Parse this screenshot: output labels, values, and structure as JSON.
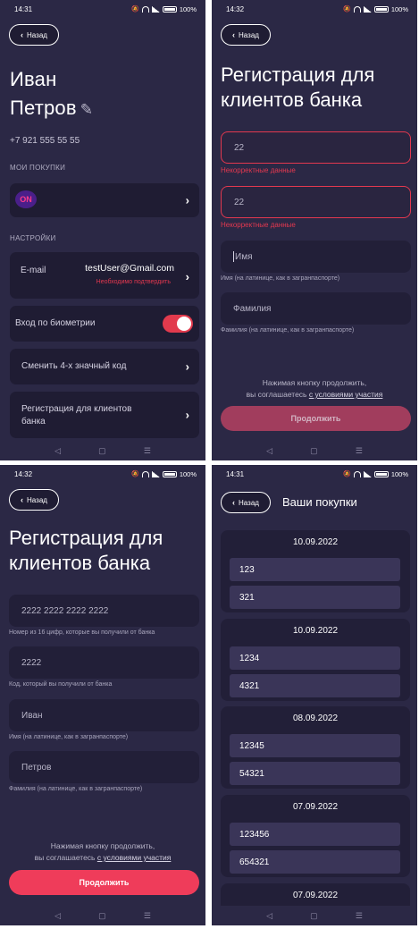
{
  "screen1": {
    "status": {
      "time": "14:31",
      "battery": "100%"
    },
    "back_label": "Назад",
    "first_name": "Иван",
    "last_name": "Петров",
    "phone": "+7 921 555 55 55",
    "purchases_header": "МОИ ПОКУПКИ",
    "partner_logo": "ON",
    "settings_header": "НАСТРОЙКИ",
    "email_label": "E-mail",
    "email_value": "testUser@Gmail.com",
    "email_warning": "Необходимо подтвердить",
    "biometric_label": "Вход по биометрии",
    "change_code_label": "Сменить 4-х значный код",
    "bank_reg_label": "Регистрация для клиентов банка"
  },
  "screen2": {
    "status": {
      "time": "14:32",
      "battery": "100%"
    },
    "back_label": "Назад",
    "title": "Регистрация для клиентов банка",
    "field1_value": "22",
    "field1_error": "Некорректные данные",
    "field2_value": "22",
    "field2_error": "Некорректные данные",
    "first_name_placeholder": "Имя",
    "first_name_hint": "Имя (на латинице, как в загранпаспорте)",
    "last_name_placeholder": "Фамилия",
    "last_name_hint": "Фамилия (на латинице, как в загранпаспорте)",
    "agree_line1": "Нажимая кнопку продолжить,",
    "agree_prefix": "вы соглашаетесь ",
    "agree_link": "с условиями участия",
    "continue_label": "Продолжить"
  },
  "screen3": {
    "status": {
      "time": "14:32",
      "battery": "100%"
    },
    "back_label": "Назад",
    "title": "Регистрация для клиентов банка",
    "card_value": "2222 2222 2222 2222",
    "card_hint": "Номер из 16 цифр, которые вы получили от банка",
    "code_value": "2222",
    "code_hint": "Код, который вы получили от банка",
    "first_name_value": "Иван",
    "first_name_hint": "Имя (на латинице, как в загранпаспорте)",
    "last_name_value": "Петров",
    "last_name_hint": "Фамилия (на латинице, как в загранпаспорте)",
    "agree_line1": "Нажимая кнопку продолжить,",
    "agree_prefix": "вы соглашаетесь ",
    "agree_link": "с условиями участия",
    "continue_label": "Продолжить"
  },
  "screen4": {
    "status": {
      "time": "14:31",
      "battery": "100%"
    },
    "back_label": "Назад",
    "title": "Ваши покупки",
    "groups": [
      {
        "date": "10.09.2022",
        "items": [
          "123",
          "321"
        ]
      },
      {
        "date": "10.09.2022",
        "items": [
          "1234",
          "4321"
        ]
      },
      {
        "date": "08.09.2022",
        "items": [
          "12345",
          "54321"
        ]
      },
      {
        "date": "07.09.2022",
        "items": [
          "123456",
          "654321"
        ]
      },
      {
        "date": "07.09.2022",
        "items": []
      }
    ]
  },
  "icons": {
    "back": "chevron-left-icon",
    "arrow": "chevron-right-icon",
    "edit": "pencil-icon",
    "nav_back": "◁",
    "nav_home": "▢",
    "nav_menu": "☰"
  },
  "colors": {
    "background": "#2b2845",
    "card": "#1f1c33",
    "accent": "#ef3c5a",
    "error": "#e3384f"
  }
}
